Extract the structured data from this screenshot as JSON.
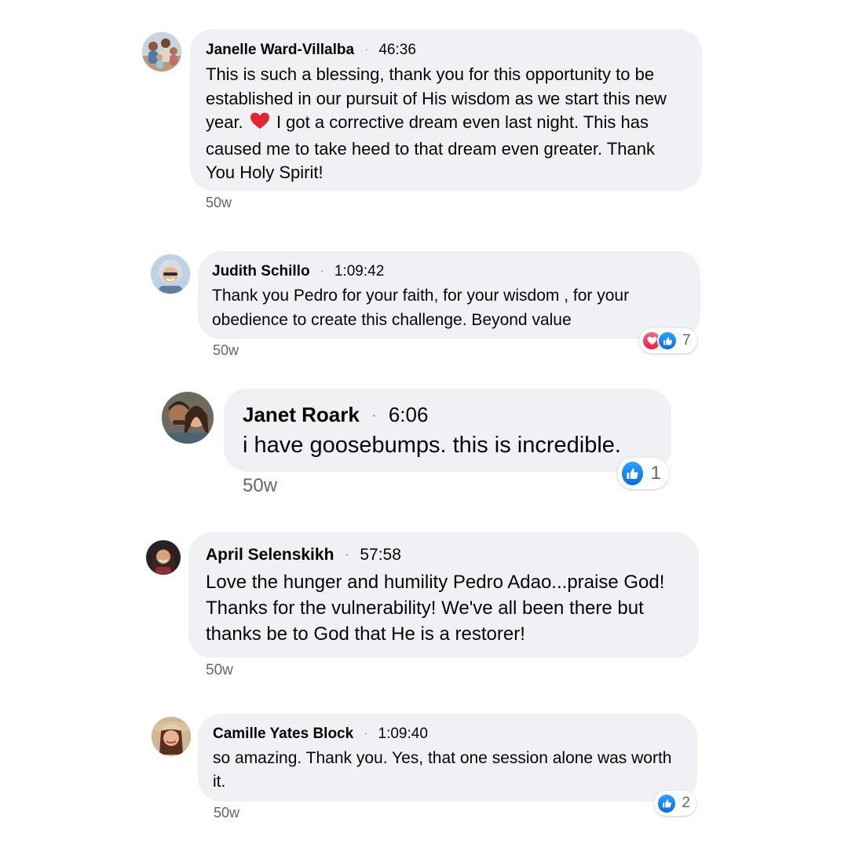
{
  "colors": {
    "bubble": "#eff1f5",
    "muted": "#65676b",
    "like_blue": "#1877f2",
    "love_red": "#f33e58",
    "separator_dot": "#d65a5a"
  },
  "comments": [
    {
      "name": "Janelle Ward-Villalba",
      "separator": "·",
      "timestamp": "46:36",
      "text_before_emoji": "This is such a blessing, thank you for this opportunity to be established in our pursuit of His wisdom as we start this new year.",
      "emoji": "red-heart-emoji",
      "text_after_emoji": "I got a corrective dream even last night. This has caused me to take heed to that dream even greater. Thank You Holy Spirit!",
      "age": "50w"
    },
    {
      "name": "Judith Schillo",
      "separator": "·",
      "timestamp": "1:09:42",
      "text": "Thank you Pedro for your faith, for your wisdom , for your obedience to create this challenge. Beyond value",
      "age": "50w",
      "reactions": {
        "icons": [
          "love-icon",
          "like-icon"
        ],
        "count": "7"
      }
    },
    {
      "name": "Janet Roark",
      "separator": "·",
      "timestamp": "6:06",
      "text": "i have goosebumps. this is incredible.",
      "age": "50w",
      "reactions": {
        "icons": [
          "like-icon"
        ],
        "count": "1"
      }
    },
    {
      "name": "April Selenskikh",
      "separator": "·",
      "timestamp": "57:58",
      "text": "Love the hunger and humility Pedro Adao...praise God! Thanks for the vulnerability! We've all been there but thanks be to God that He is a restorer!",
      "age": "50w"
    },
    {
      "name": "Camille Yates Block",
      "separator": "·",
      "timestamp": "1:09:40",
      "text": "so amazing. Thank you. Yes, that one session alone was worth it.",
      "age": "50w",
      "reactions": {
        "icons": [
          "like-icon"
        ],
        "count": "2"
      }
    }
  ]
}
